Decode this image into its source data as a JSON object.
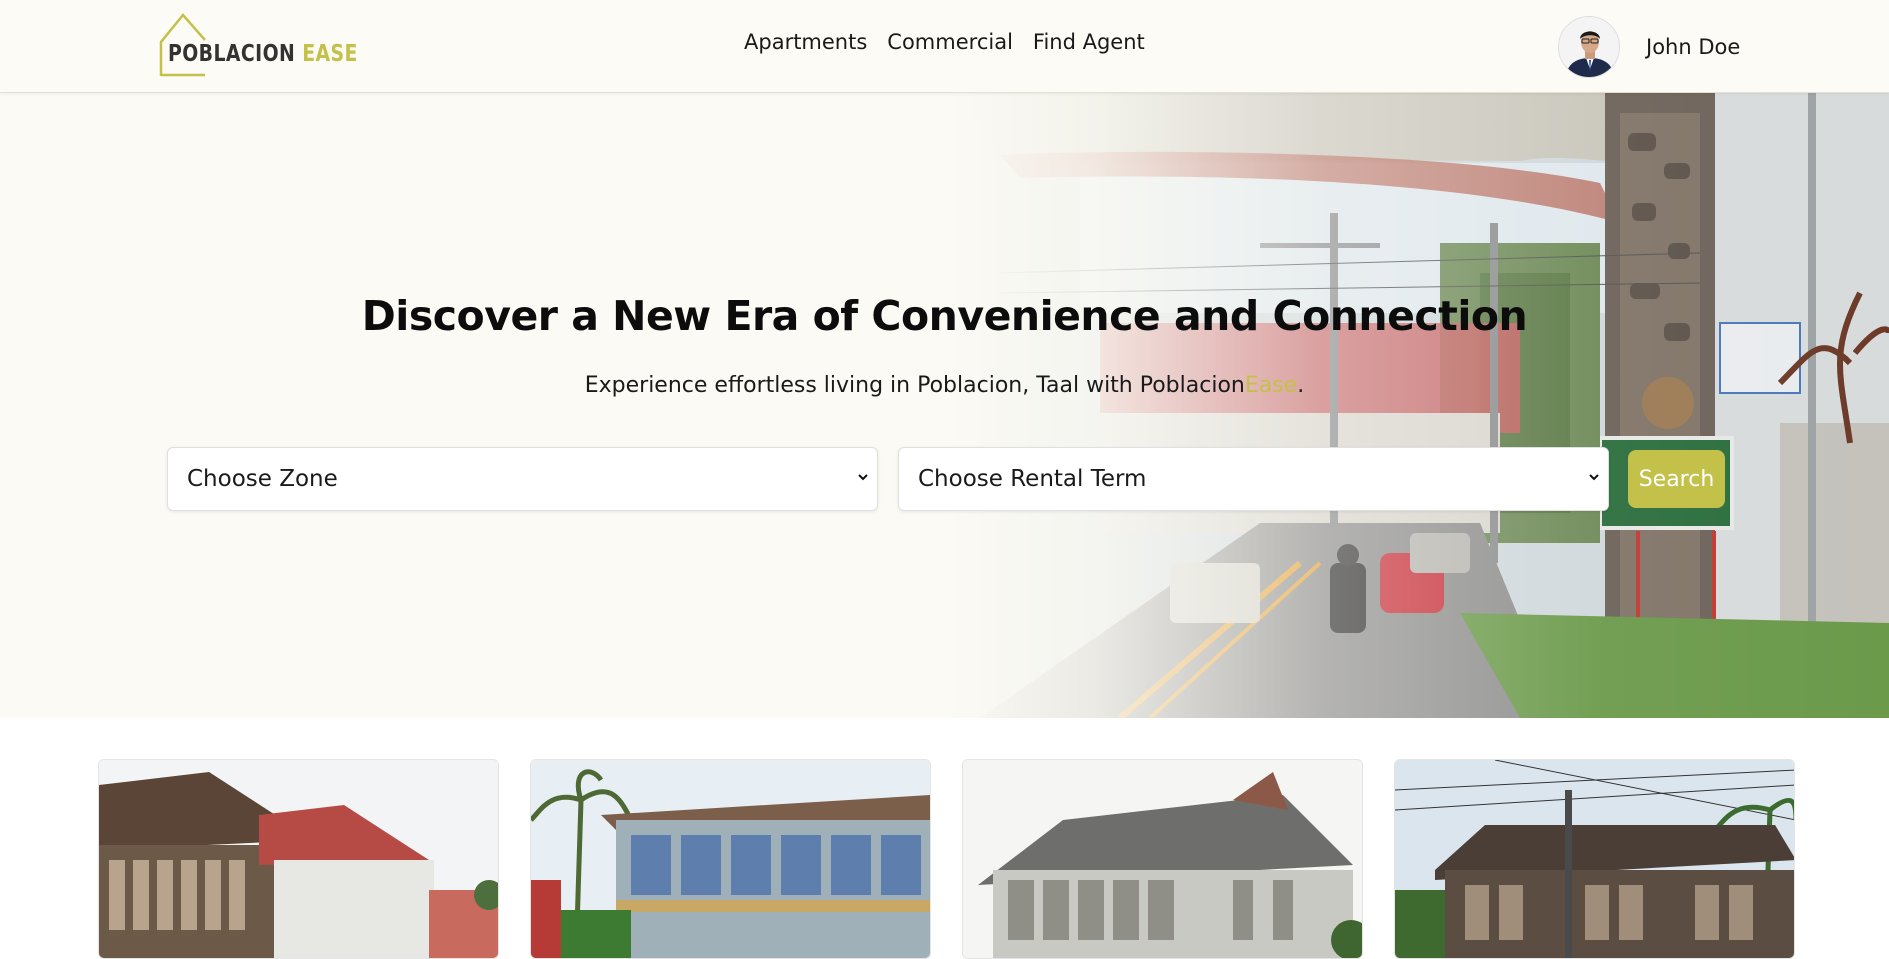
{
  "brand": {
    "name_part1": "POBLACION",
    "name_part2": "EASE",
    "accent_color": "#c3c14a"
  },
  "nav": {
    "links": [
      {
        "label": "Apartments"
      },
      {
        "label": "Commercial"
      },
      {
        "label": "Find Agent"
      }
    ]
  },
  "user": {
    "name": "John Doe",
    "avatar_icon": "user-avatar"
  },
  "hero": {
    "title": "Discover a New Era of Convenience and Connection",
    "subtitle_prefix": "Experience effortless living in Poblacion, Taal with Poblacion",
    "subtitle_accent": "Ease",
    "subtitle_suffix": ".",
    "zone_select": {
      "selected": "Choose Zone"
    },
    "term_select": {
      "selected": "Choose Rental Term"
    },
    "search_label": "Search"
  },
  "listings": [
    {
      "image": "heritage-house-photo"
    },
    {
      "image": "heritage-house-photo"
    },
    {
      "image": "heritage-house-photo"
    },
    {
      "image": "heritage-house-photo"
    }
  ]
}
